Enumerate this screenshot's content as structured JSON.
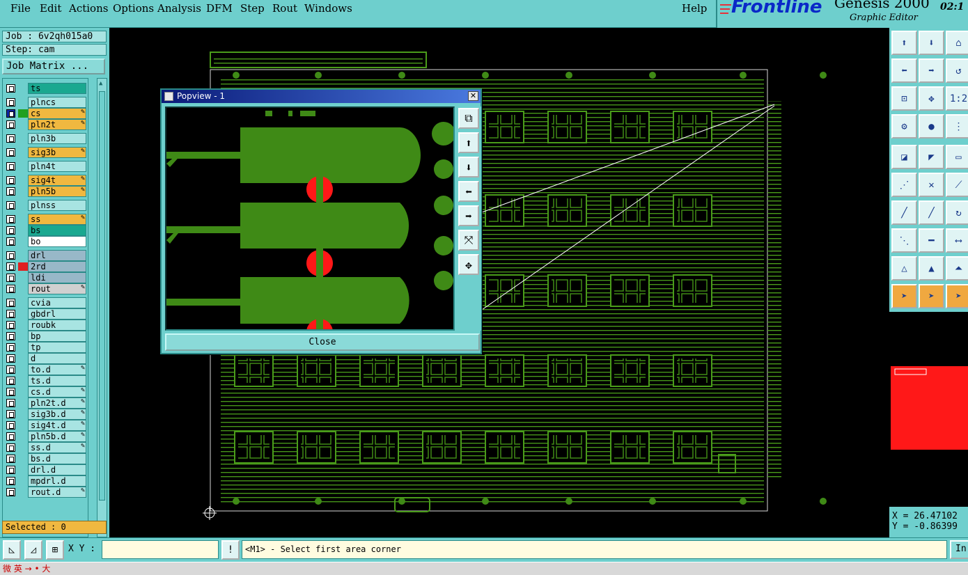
{
  "menu": {
    "file": "File",
    "edit": "Edit",
    "actions": "Actions",
    "options": "Options",
    "analysis": "Analysis",
    "dfm": "DFM",
    "step": "Step",
    "rout": "Rout",
    "windows": "Windows",
    "help": "Help"
  },
  "brand": {
    "logo": "Frontline",
    "product": "Genesis 2000",
    "subtitle": "Graphic Editor",
    "clock": "02:1"
  },
  "job": {
    "job_label": "Job : 6v2qh015a0",
    "step_label": "Step: cam",
    "matrix_button": "Job Matrix ..."
  },
  "layers": [
    {
      "name": "ts",
      "color": "#1aa890"
    },
    {
      "name": "plncs",
      "color": "#a8e4e2"
    },
    {
      "name": "cs",
      "color": "#f0b840",
      "edit": true,
      "selected": true,
      "marker": "#20a020"
    },
    {
      "name": "pln2t",
      "color": "#f0b840",
      "edit": true
    },
    {
      "name": "pln3b",
      "color": "#a8e4e2"
    },
    {
      "name": "sig3b",
      "color": "#f0b840",
      "edit": true
    },
    {
      "name": "pln4t",
      "color": "#a8e4e2"
    },
    {
      "name": "sig4t",
      "color": "#f0b840",
      "edit": true
    },
    {
      "name": "pln5b",
      "color": "#f0b840",
      "edit": true
    },
    {
      "name": "plnss",
      "color": "#a8e4e2"
    },
    {
      "name": "ss",
      "color": "#f0b840",
      "edit": true
    },
    {
      "name": "bs",
      "color": "#1aa890"
    },
    {
      "name": "bo",
      "color": "#ffffff"
    },
    {
      "name": "drl",
      "color": "#98b8c8"
    },
    {
      "name": "2rd",
      "color": "#98b8c8",
      "marker": "#e02020"
    },
    {
      "name": "ldi",
      "color": "#98b8c8"
    },
    {
      "name": "rout",
      "color": "#d0d0d0",
      "edit": true
    },
    {
      "name": "cvia",
      "color": "#a8e4e2"
    },
    {
      "name": "gbdrl",
      "color": "#a8e4e2"
    },
    {
      "name": "roubk",
      "color": "#a8e4e2"
    },
    {
      "name": "bp",
      "color": "#a8e4e2"
    },
    {
      "name": "tp",
      "color": "#a8e4e2"
    },
    {
      "name": "d",
      "color": "#a8e4e2"
    },
    {
      "name": "to.d",
      "color": "#a8e4e2",
      "edit": true
    },
    {
      "name": "ts.d",
      "color": "#a8e4e2"
    },
    {
      "name": "cs.d",
      "color": "#a8e4e2",
      "edit": true
    },
    {
      "name": "pln2t.d",
      "color": "#a8e4e2",
      "edit": true
    },
    {
      "name": "sig3b.d",
      "color": "#a8e4e2",
      "edit": true
    },
    {
      "name": "sig4t.d",
      "color": "#a8e4e2",
      "edit": true
    },
    {
      "name": "pln5b.d",
      "color": "#a8e4e2",
      "edit": true
    },
    {
      "name": "ss.d",
      "color": "#a8e4e2",
      "edit": true
    },
    {
      "name": "bs.d",
      "color": "#a8e4e2"
    },
    {
      "name": "drl.d",
      "color": "#a8e4e2"
    },
    {
      "name": "mpdrl.d",
      "color": "#a8e4e2"
    },
    {
      "name": "rout.d",
      "color": "#a8e4e2",
      "edit": true
    }
  ],
  "status": {
    "selected": "Selected : 0",
    "xy_label": "X Y :",
    "xy_value": "",
    "message": "<M1> - Select first area corner",
    "in_button": "In"
  },
  "coords": {
    "x": "X = 26.47102",
    "y": "Y = -0.86399"
  },
  "popup": {
    "title": "Popview - 1",
    "close_label": "Close"
  },
  "colors": {
    "board": "#3f8a16",
    "trace": "#4a9c1a",
    "pad_red": "#ff1818",
    "bg": "#6ecfcd"
  },
  "taskbar": {
    "text": "微 英 → • 大"
  }
}
